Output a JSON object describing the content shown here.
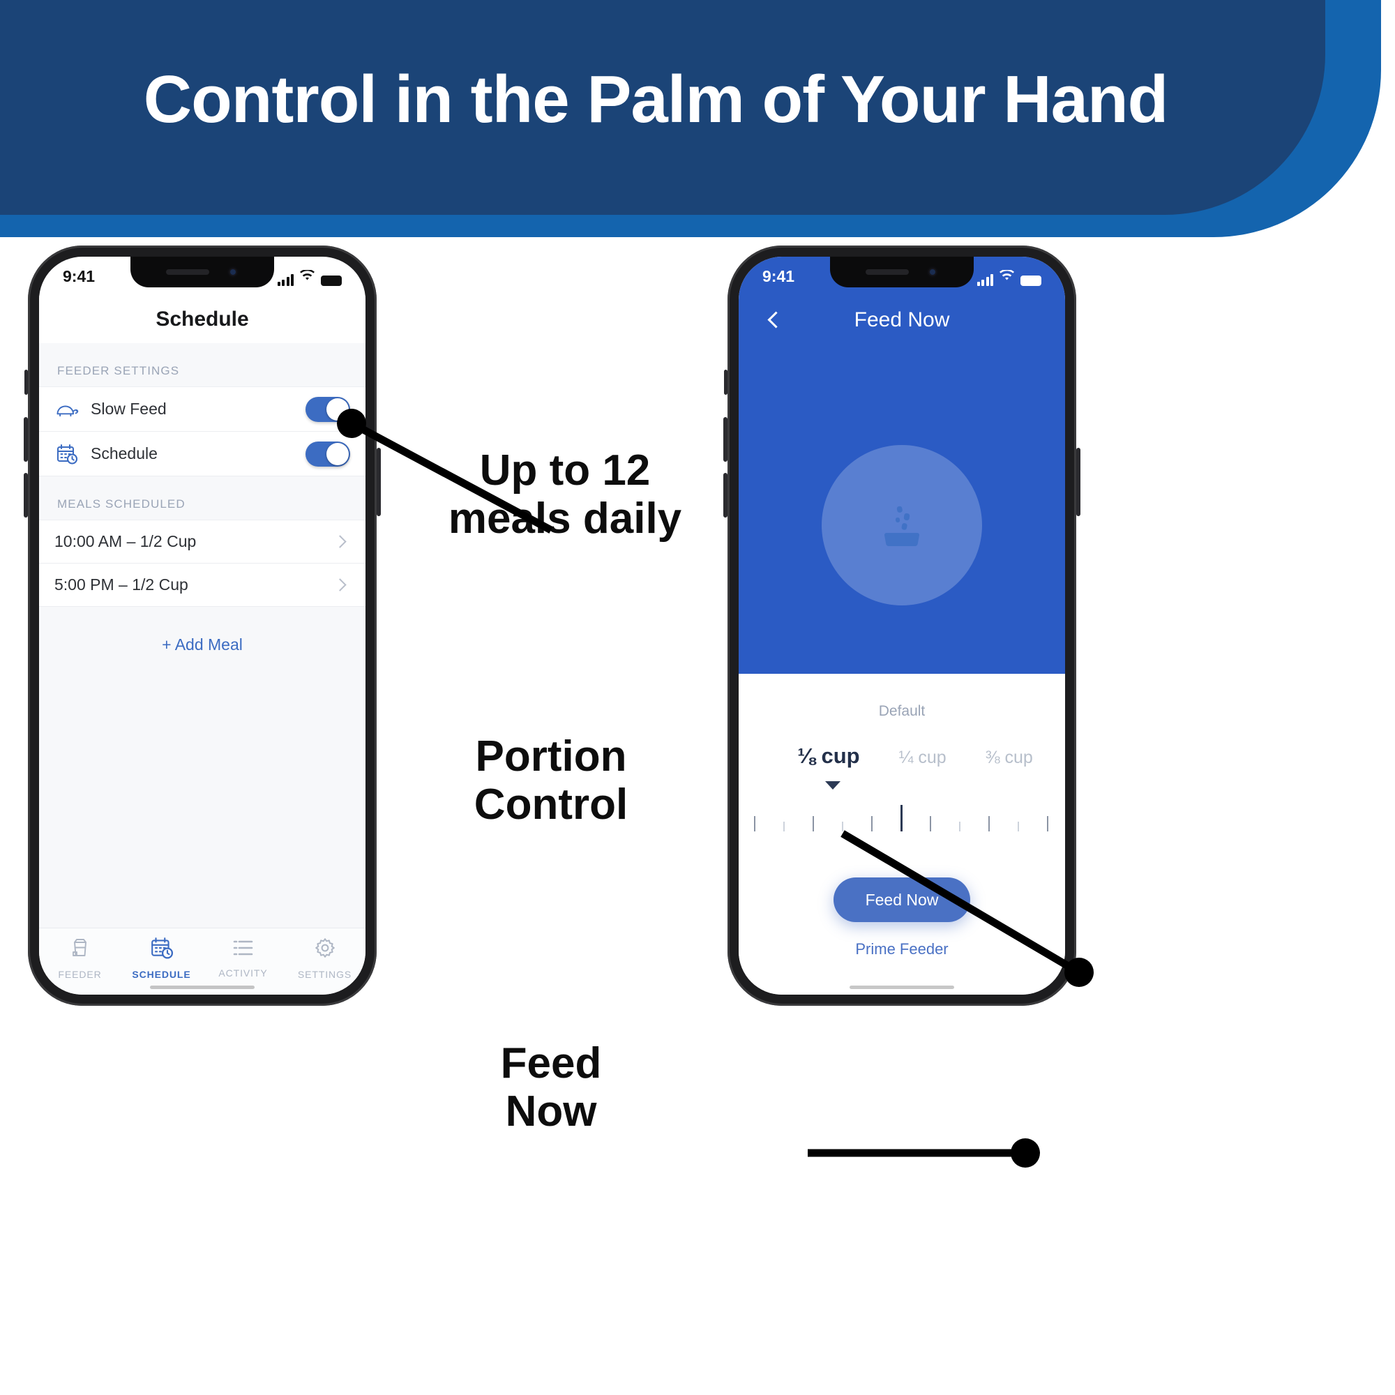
{
  "banner": {
    "title": "Control in the Palm of Your Hand",
    "bg_dark": "#1b4477",
    "bg_light": "#1464ae"
  },
  "callouts": [
    {
      "id": "meals",
      "line1": "Up to 12",
      "line2": "meals daily"
    },
    {
      "id": "portion",
      "line1": "Portion",
      "line2": "Control"
    },
    {
      "id": "feed",
      "line1": "Feed",
      "line2": "Now"
    }
  ],
  "left_phone": {
    "status": {
      "time": "9:41",
      "signal_icon": "cellular-bars-icon",
      "wifi_icon": "wifi-icon",
      "battery_icon": "battery-full-icon"
    },
    "nav_title": "Schedule",
    "sections": [
      {
        "header": "FEEDER SETTINGS"
      },
      {
        "header": "MEALS SCHEDULED"
      }
    ],
    "settings_rows": [
      {
        "label": "Slow Feed",
        "icon": "turtle-icon",
        "toggle_on": true
      },
      {
        "label": "Schedule",
        "icon": "calendar-clock-icon",
        "toggle_on": true
      }
    ],
    "meals": [
      {
        "text": "10:00 AM  –  1/2 Cup",
        "chevron": "chevron-right-icon"
      },
      {
        "text": "5:00 PM  –  1/2 Cup",
        "chevron": "chevron-right-icon"
      }
    ],
    "add_meal_label": "+ Add Meal",
    "tabs": [
      {
        "label": "FEEDER",
        "icon": "food-bag-icon",
        "active": false
      },
      {
        "label": "SCHEDULE",
        "icon": "calendar-clock-icon",
        "active": true
      },
      {
        "label": "ACTIVITY",
        "icon": "list-icon",
        "active": false
      },
      {
        "label": "SETTINGS",
        "icon": "gear-icon",
        "active": false
      }
    ],
    "accent_color": "#3c6cc2"
  },
  "right_phone": {
    "status": {
      "time": "9:41",
      "signal_icon": "cellular-bars-icon",
      "wifi_icon": "wifi-icon",
      "battery_icon": "battery-full-icon"
    },
    "nav_title": "Feed Now",
    "back_icon": "chevron-left-icon",
    "hero_icon": "food-bowl-icon",
    "default_label": "Default",
    "portions": [
      {
        "label": "⅛ cup",
        "selected": true
      },
      {
        "label": "¼ cup",
        "selected": false
      },
      {
        "label": "⅜ cup",
        "selected": false
      }
    ],
    "caret_icon": "caret-down-icon",
    "feed_button_label": "Feed Now",
    "prime_link_label": "Prime Feeder",
    "header_bg": "#2b5bc4",
    "button_color": "#4a71c4"
  }
}
